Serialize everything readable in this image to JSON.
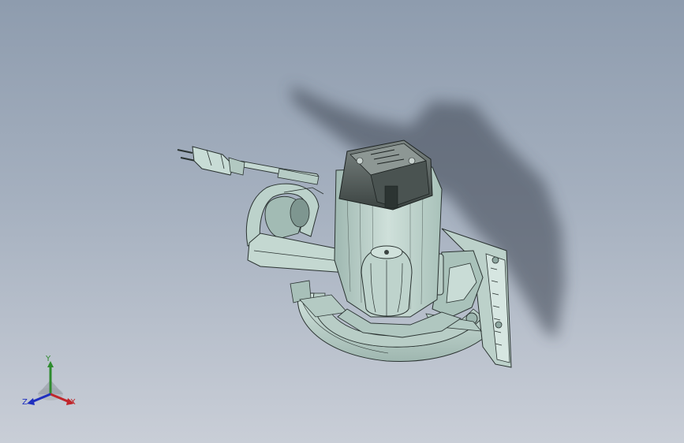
{
  "viewport": {
    "background_top": "#8e9cae",
    "background_bottom": "#c9ced7",
    "model_color": "#c8dcd6",
    "model_edge_color": "#2a3331"
  },
  "triad": {
    "x_label": "X",
    "y_label": "Y",
    "z_label": "Z",
    "x_color": "#c0262b",
    "y_color": "#2e8b2e",
    "z_color": "#1f2fbf"
  }
}
